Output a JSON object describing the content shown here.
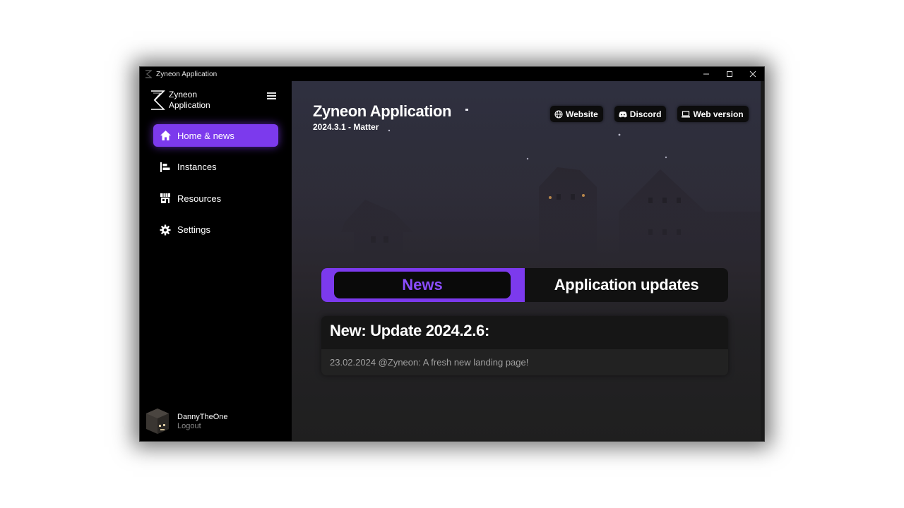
{
  "window": {
    "title": "Zyneon Application",
    "controls": [
      "minimize",
      "maximize",
      "close"
    ]
  },
  "sidebar": {
    "brand": {
      "line1": "Zyneon",
      "line2": "Application"
    },
    "items": [
      {
        "label": "Home & news",
        "icon": "home-icon",
        "active": true
      },
      {
        "label": "Instances",
        "icon": "instances-icon",
        "active": false
      },
      {
        "label": "Resources",
        "icon": "store-icon",
        "active": false
      },
      {
        "label": "Settings",
        "icon": "gear-icon",
        "active": false
      }
    ],
    "user": {
      "name": "DannyTheOne",
      "logout": "Logout"
    }
  },
  "main": {
    "title": "Zyneon Application",
    "version": "2024.3.1 - Matter",
    "links": [
      {
        "label": "Website",
        "icon": "globe-icon"
      },
      {
        "label": "Discord",
        "icon": "discord-icon"
      },
      {
        "label": "Web version",
        "icon": "laptop-icon"
      }
    ],
    "tabs": [
      {
        "label": "News",
        "active": true
      },
      {
        "label": "Application updates",
        "active": false
      }
    ],
    "news": [
      {
        "title": "New: Update 2024.2.6:",
        "body": "23.02.2024 @Zyneon: A fresh new landing page!"
      }
    ]
  },
  "colors": {
    "accent": "#7c3aed",
    "accent_text": "#8b4dff",
    "background": "#000000"
  }
}
